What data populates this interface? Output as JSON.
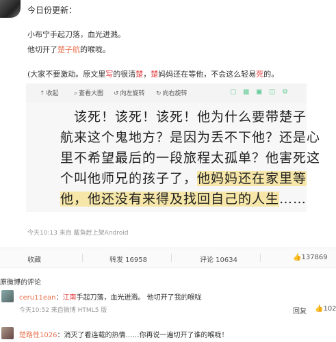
{
  "header": {
    "title": "今日份更新："
  },
  "post": {
    "line1": "小布宁手起刀落，血光迸溅。",
    "line2_pre": "他切开了",
    "line2_link": "楚子航",
    "line2_post": "的喉咙。",
    "line3_a": "(大家不要激动。原文里",
    "line3_b": "写",
    "line3_c": "的很清",
    "line3_d": "楚",
    "line3_e": "，",
    "line3_f": "楚",
    "line3_g": "妈妈还在等他，不会这么轻易",
    "line3_h": "死",
    "line3_i": "的。"
  },
  "image_toolbar": {
    "collapse": "收起",
    "view_large": "查看大图",
    "rotate_left": "向左旋转",
    "rotate_right": "向右旋转"
  },
  "book_text": {
    "l1": "该死！该死！该死！他为什么要带楚子",
    "l2": "航来这个鬼地方？是因为丢不下他？还是心",
    "l3": "里不希望最后的一段旅程太孤单？他害死这",
    "l4a": "个叫他师兄的孩子了，",
    "l4b": "他妈妈还在家里等",
    "l5a": "他，他还没有来得及找回自己的人生",
    "l5b": "……"
  },
  "meta": {
    "text": "今天10:13 来自 戴鱼赶上架Android"
  },
  "actions": {
    "collect": "收藏",
    "repost": "转发 16958",
    "comment": "评论 10634",
    "like": "137869"
  },
  "original_comments_title": "原微博的评论",
  "comments": [
    {
      "user": "ceru11ean",
      "sep": "：",
      "text_red": "江南",
      "text": "手起刀落，血光迸溅。 他切开了我的喉咙",
      "meta": "今天10:52 来自微博 HTML5 版",
      "reply": "回复",
      "likes": "102"
    },
    {
      "user": "楚路性1026",
      "sep": "：",
      "text": "消灭了看连载的热情……你再说一遍切开了谁的喉咙！"
    }
  ],
  "colors": {
    "accent": "#eb7350",
    "highlight": "#f6e6a8"
  }
}
